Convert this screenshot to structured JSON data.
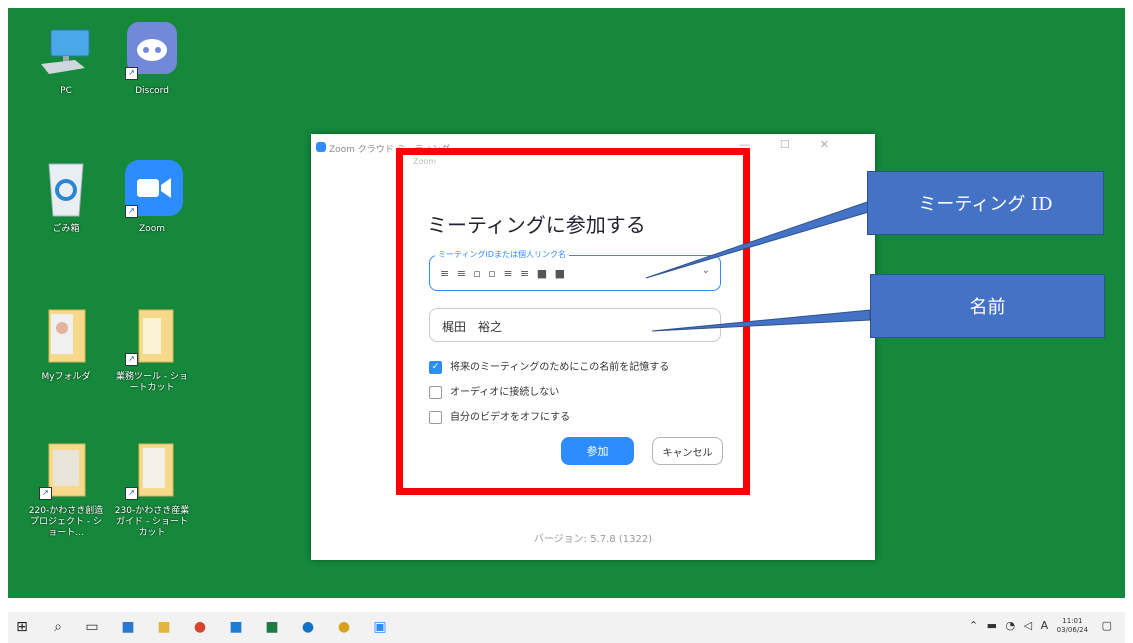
{
  "desktop": {
    "background_color": "#15883c",
    "icons": [
      {
        "label": "PC",
        "icon": "pc-icon"
      },
      {
        "label": "Discord",
        "icon": "discord-icon"
      },
      {
        "label": "ごみ箱",
        "icon": "recycle-bin-icon"
      },
      {
        "label": "Zoom",
        "icon": "zoom-icon"
      },
      {
        "label": "Myフォルダ",
        "icon": "folder-icon"
      },
      {
        "label": "業務ツール - ショートカット",
        "icon": "folder-icon"
      },
      {
        "label": "220-かわさき創造プロジェクト - ショート...",
        "icon": "folder-icon"
      },
      {
        "label": "230-かわさき産業ガイド - ショートカット",
        "icon": "folder-icon"
      }
    ]
  },
  "zoom_window": {
    "title": "Zoom クラウド ミーティング",
    "version": "バージョン: 5.7.8 (1322)",
    "dialog": {
      "topbar": "Zoom",
      "title": "ミーティングに参加する",
      "meeting_field_label": "ミーティングIDまたは個人リンク名",
      "meeting_field_value": "≡ ≡ ▫ ▫ ≡ ≡ ■ ■",
      "name_value": "梶田　裕之",
      "options": [
        {
          "label": "将来のミーティングのためにこの名前を記憶する",
          "checked": true
        },
        {
          "label": "オーディオに接続しない",
          "checked": false
        },
        {
          "label": "自分のビデオをオフにする",
          "checked": false
        }
      ],
      "join_button": "参加",
      "cancel_button": "キャンセル"
    }
  },
  "callouts": {
    "meeting_id": "ミーティング ID",
    "name": "名前",
    "color": "#4472c4"
  },
  "taskbar": {
    "time": "11:01",
    "date": "03/06/24",
    "ime": "A"
  }
}
